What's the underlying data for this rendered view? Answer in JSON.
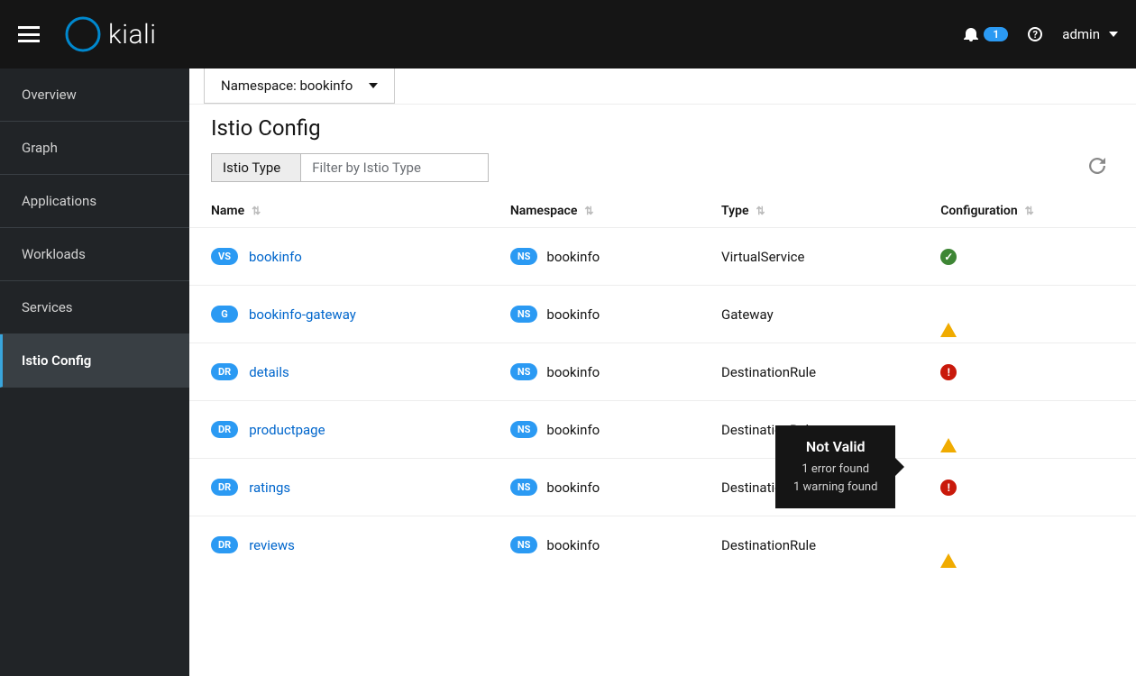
{
  "header": {
    "brand": "kiali",
    "notification_count": "1",
    "username": "admin"
  },
  "sidebar": {
    "items": [
      {
        "label": "Overview"
      },
      {
        "label": "Graph"
      },
      {
        "label": "Applications"
      },
      {
        "label": "Workloads"
      },
      {
        "label": "Services"
      },
      {
        "label": "Istio Config"
      }
    ],
    "active_index": 5
  },
  "namespace_selector": {
    "label": "Namespace: bookinfo"
  },
  "page": {
    "title": "Istio Config"
  },
  "filters": {
    "type_label": "Istio Type",
    "placeholder": "Filter by Istio Type"
  },
  "columns": {
    "name": "Name",
    "namespace": "Namespace",
    "type": "Type",
    "configuration": "Configuration"
  },
  "rows": [
    {
      "badge": "VS",
      "name": "bookinfo",
      "ns_badge": "NS",
      "namespace": "bookinfo",
      "type": "VirtualService",
      "config": "ok"
    },
    {
      "badge": "G",
      "name": "bookinfo-gateway",
      "ns_badge": "NS",
      "namespace": "bookinfo",
      "type": "Gateway",
      "config": "warn"
    },
    {
      "badge": "DR",
      "name": "details",
      "ns_badge": "NS",
      "namespace": "bookinfo",
      "type": "DestinationRule",
      "config": "error"
    },
    {
      "badge": "DR",
      "name": "productpage",
      "ns_badge": "NS",
      "namespace": "bookinfo",
      "type": "DestinationRule",
      "config": "warn"
    },
    {
      "badge": "DR",
      "name": "ratings",
      "ns_badge": "NS",
      "namespace": "bookinfo",
      "type": "DestinationRule",
      "config": "error"
    },
    {
      "badge": "DR",
      "name": "reviews",
      "ns_badge": "NS",
      "namespace": "bookinfo",
      "type": "DestinationRule",
      "config": "warn"
    }
  ],
  "tooltip": {
    "title": "Not Valid",
    "line1": "1 error found",
    "line2": "1 warning found",
    "visible_row": 2
  }
}
